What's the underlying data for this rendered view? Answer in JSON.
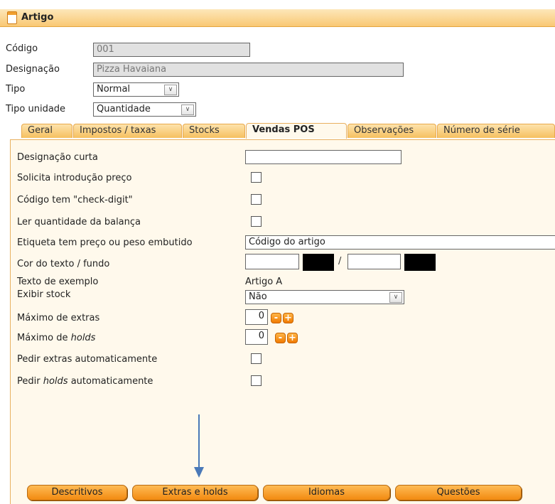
{
  "header": {
    "title": "Artigo"
  },
  "form": {
    "codigo": {
      "label": "Código",
      "value": "001"
    },
    "designacao": {
      "label": "Designação",
      "value": "Pizza Havaiana"
    },
    "tipo": {
      "label": "Tipo",
      "value": "Normal"
    },
    "tipo_unidade": {
      "label": "Tipo unidade",
      "value": "Quantidade"
    }
  },
  "tabs": [
    {
      "label": "Geral",
      "active": false
    },
    {
      "label": "Impostos / taxas",
      "active": false
    },
    {
      "label": "Stocks",
      "active": false
    },
    {
      "label": "Vendas POS",
      "active": true
    },
    {
      "label": "Observações",
      "active": false
    },
    {
      "label": "Número de série",
      "active": false
    }
  ],
  "vendas_pos": {
    "designacao_curta": {
      "label": "Designação curta",
      "value": ""
    },
    "solicita_preco": {
      "label": "Solicita introdução preço",
      "checked": false
    },
    "check_digit": {
      "label": "Código tem \"check-digit\"",
      "checked": false
    },
    "ler_balanca": {
      "label": "Ler quantidade da balança",
      "checked": false
    },
    "etiqueta": {
      "label": "Etiqueta tem preço ou peso embutido",
      "value": "Código do artigo"
    },
    "cor": {
      "label": "Cor do texto / fundo",
      "separator": "/",
      "text_color": "#000000",
      "bg_color": "#000000"
    },
    "texto_exemplo": {
      "label": "Texto de exemplo",
      "value": "Artigo A"
    },
    "exibir_stock": {
      "label": "Exibir stock",
      "value": "Não"
    },
    "max_extras": {
      "label": "Máximo de extras",
      "value": "0"
    },
    "max_holds": {
      "label_prefix": "Máximo de ",
      "label_em": "holds",
      "value": "0"
    },
    "pedir_extras": {
      "label": "Pedir extras automaticamente",
      "checked": false
    },
    "pedir_holds": {
      "label_prefix": "Pedir ",
      "label_em": "holds",
      "label_suffix": " automaticamente",
      "checked": false
    },
    "stepper_minus": "-",
    "stepper_plus": "+"
  },
  "buttons": {
    "descritivos": "Descritivos",
    "extras_holds": "Extras e holds",
    "idiomas": "Idiomas",
    "questoes": "Questões"
  },
  "colors": {
    "accent": "#f28a10",
    "panel": "#fff9ec",
    "arrow": "#4a79b8"
  }
}
